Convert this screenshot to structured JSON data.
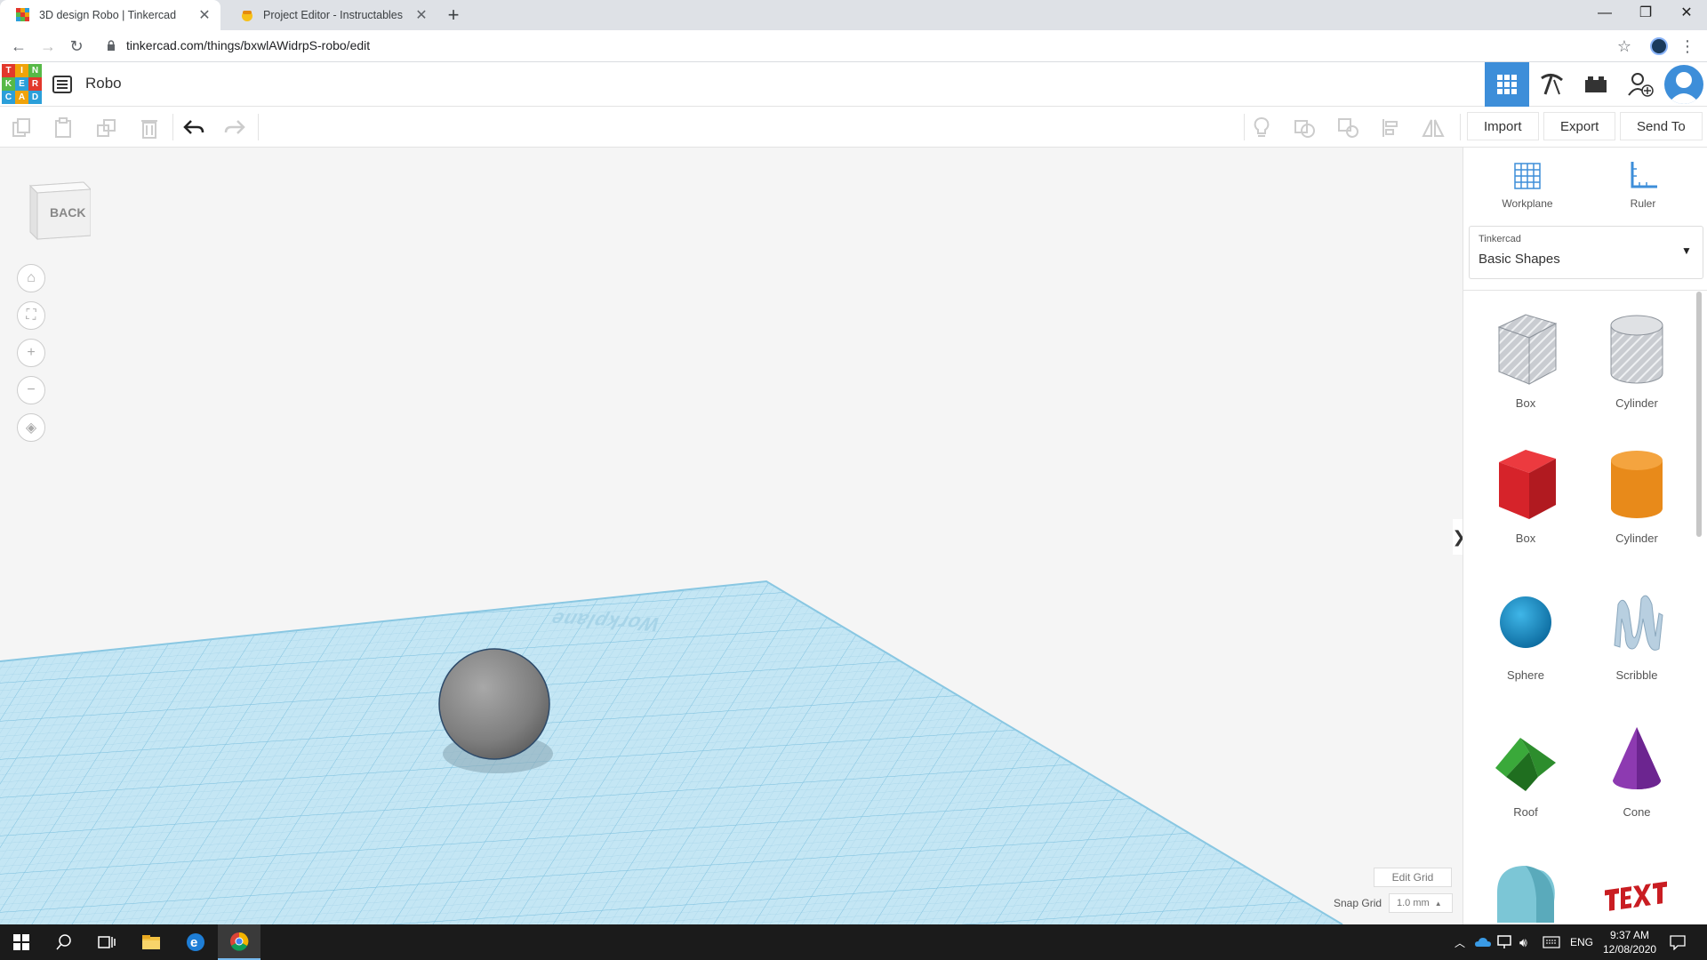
{
  "browser": {
    "tabs": [
      {
        "title": "3D design Robo | Tinkercad",
        "active": true
      },
      {
        "title": "Project Editor - Instructables",
        "active": false
      }
    ],
    "url": "tinkercad.com/things/bxwlAWidrpS-robo/edit"
  },
  "app": {
    "logo_letters": [
      "T",
      "I",
      "N",
      "K",
      "E",
      "R",
      "C",
      "A",
      "D"
    ],
    "project_name": "Robo"
  },
  "toolbar": {
    "import_label": "Import",
    "export_label": "Export",
    "sendto_label": "Send To"
  },
  "viewcube": {
    "label": "BACK"
  },
  "canvas": {
    "workplane_label": "Workplane",
    "edit_grid_label": "Edit Grid",
    "snap_grid_label": "Snap Grid",
    "snap_grid_value": "1.0 mm"
  },
  "panel": {
    "workplane_label": "Workplane",
    "ruler_label": "Ruler",
    "library_provider": "Tinkercad",
    "library_name": "Basic Shapes",
    "shapes": [
      {
        "label": "Box"
      },
      {
        "label": "Cylinder"
      },
      {
        "label": "Box"
      },
      {
        "label": "Cylinder"
      },
      {
        "label": "Sphere"
      },
      {
        "label": "Scribble"
      },
      {
        "label": "Roof"
      },
      {
        "label": "Cone"
      }
    ]
  },
  "taskbar": {
    "language": "ENG",
    "time": "9:37 AM",
    "date": "12/08/2020"
  },
  "colors": {
    "accent_blue": "#3d8ed9",
    "workplane": "#bfe3f2",
    "box_red": "#d6232a",
    "cylinder_orange": "#e88a1a",
    "sphere_blue": "#1a8ec8",
    "roof_green": "#3aa93a",
    "cone_purple": "#8d3ab1"
  }
}
